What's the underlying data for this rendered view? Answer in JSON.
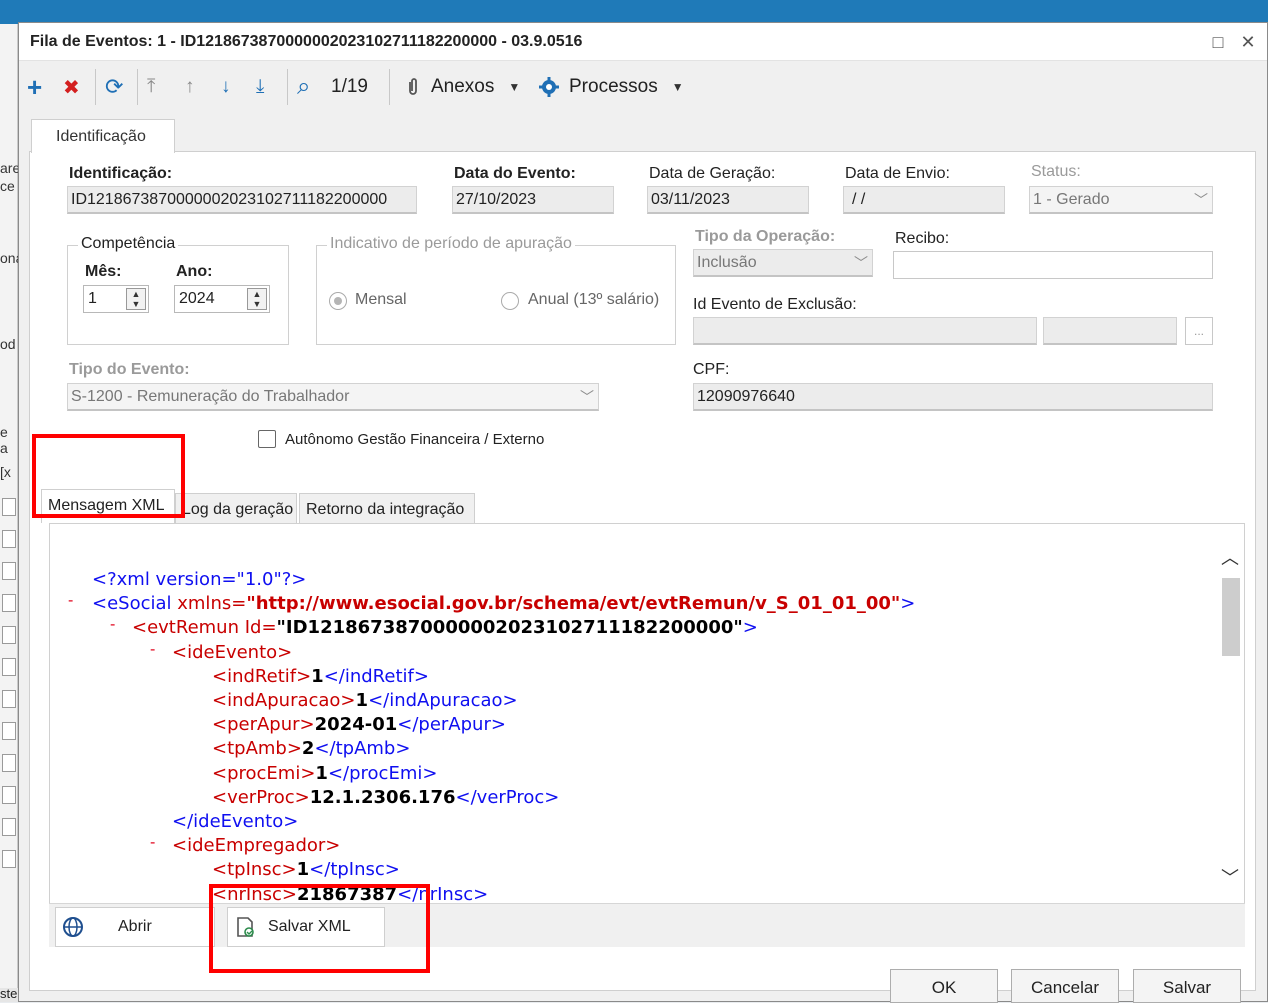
{
  "dialog": {
    "title": "Fila de Eventos: 1 - ID1218673870000002023102711182200000 - 03.9.0516",
    "maximize_icon": "□",
    "close_icon": "✕"
  },
  "toolbar": {
    "add_icon": "+",
    "delete_icon": "✖",
    "refresh_icon": "⟳",
    "first_icon": "⤒",
    "prev_icon": "↑",
    "next_icon": "↓",
    "last_icon": "⤓",
    "search_icon": "⌕",
    "record_counter": "1/19",
    "attachments_label": "Anexos",
    "processes_label": "Processos",
    "dropdown_icon": "▼"
  },
  "tabs": {
    "identificacao": "Identificação"
  },
  "form": {
    "identificacao_label": "Identificação:",
    "identificacao_value": "ID1218673870000002023102711182200000",
    "data_evento_label": "Data do Evento:",
    "data_evento_value": "27/10/2023",
    "data_geracao_label": "Data de Geração:",
    "data_geracao_value": "03/11/2023",
    "data_envio_label": "Data de Envio:",
    "data_envio_value": " / /",
    "status_label": "Status:",
    "status_value": "1 - Gerado",
    "competencia_label": "Competência",
    "mes_label": "Mês:",
    "mes_value": "1",
    "ano_label": "Ano:",
    "ano_value": "2024",
    "indicativo_label": "Indicativo de período de apuração",
    "mensal_label": "Mensal",
    "anual_label": "Anual (13º salário)",
    "tipo_operacao_label": "Tipo da Operação:",
    "tipo_operacao_value": "Inclusão",
    "recibo_label": "Recibo:",
    "recibo_value": "",
    "id_evento_exclusao_label": "Id Evento de Exclusão:",
    "ellipsis_label": "...",
    "tipo_evento_label": "Tipo do Evento:",
    "tipo_evento_value": "S-1200 - Remuneração do Trabalhador",
    "cpf_label": "CPF:",
    "cpf_value": "12090976640",
    "autonomo_label": "Autônomo Gestão Financeira / Externo"
  },
  "subtabs": {
    "mensagem_xml": "Mensagem XML",
    "log_geracao": "Log da geração",
    "retorno_integracao": "Retorno da integração"
  },
  "xml": {
    "collapse_marker": "-",
    "line1": "<?xml version=\"1.0\"?>",
    "esocial_open": "<eSocial ",
    "esocial_attr": "xmlns=",
    "esocial_ns": "\"http://www.esocial.gov.br/schema/evt/evtRemun/v_S_01_01_00\"",
    "esocial_close": ">",
    "evtremun_open": "<evtRemun Id=",
    "evtremun_id": "\"ID1218673870000002023102711182200000\"",
    "evtremun_close": ">",
    "ideevento_open": "<ideEvento>",
    "indretif_open": "<indRetif>",
    "indretif_val": "1",
    "indretif_close": "</indRetif>",
    "indapuracao_open": "<indApuracao>",
    "indapuracao_val": "1",
    "indapuracao_close": "</indApuracao>",
    "perapur_open": "<perApur>",
    "perapur_val": "2024-01",
    "perapur_close": "</perApur>",
    "tpamb_open": "<tpAmb>",
    "tpamb_val": "2",
    "tpamb_close": "</tpAmb>",
    "procemi_open": "<procEmi>",
    "procemi_val": "1",
    "procemi_close": "</procEmi>",
    "verproc_open": "<verProc>",
    "verproc_val": "12.1.2306.176",
    "verproc_close": "</verProc>",
    "ideevento_close": "</ideEvento>",
    "ideempregador_open": "<ideEmpregador>",
    "tpinsc_open": "<tpInsc>",
    "tpinsc_val": "1",
    "tpinsc_close": "</tpInsc>",
    "nrinsc_open": "<nrInsc>",
    "nrinsc_val": "21867387",
    "nrinsc_close": "</nrInsc>"
  },
  "scroll": {
    "up_icon": "︿",
    "down_icon": "﹀"
  },
  "bottom": {
    "abrir_label": "Abrir",
    "salvar_xml_label": "Salvar XML",
    "globe_icon": "🌐"
  },
  "buttons": {
    "ok": "OK",
    "cancelar": "Cancelar",
    "salvar": "Salvar"
  },
  "background": {
    "left_fragments": [
      "are",
      "ce",
      "ona",
      "od",
      "e a",
      "[x"
    ],
    "bottom_fragment": "ste"
  }
}
